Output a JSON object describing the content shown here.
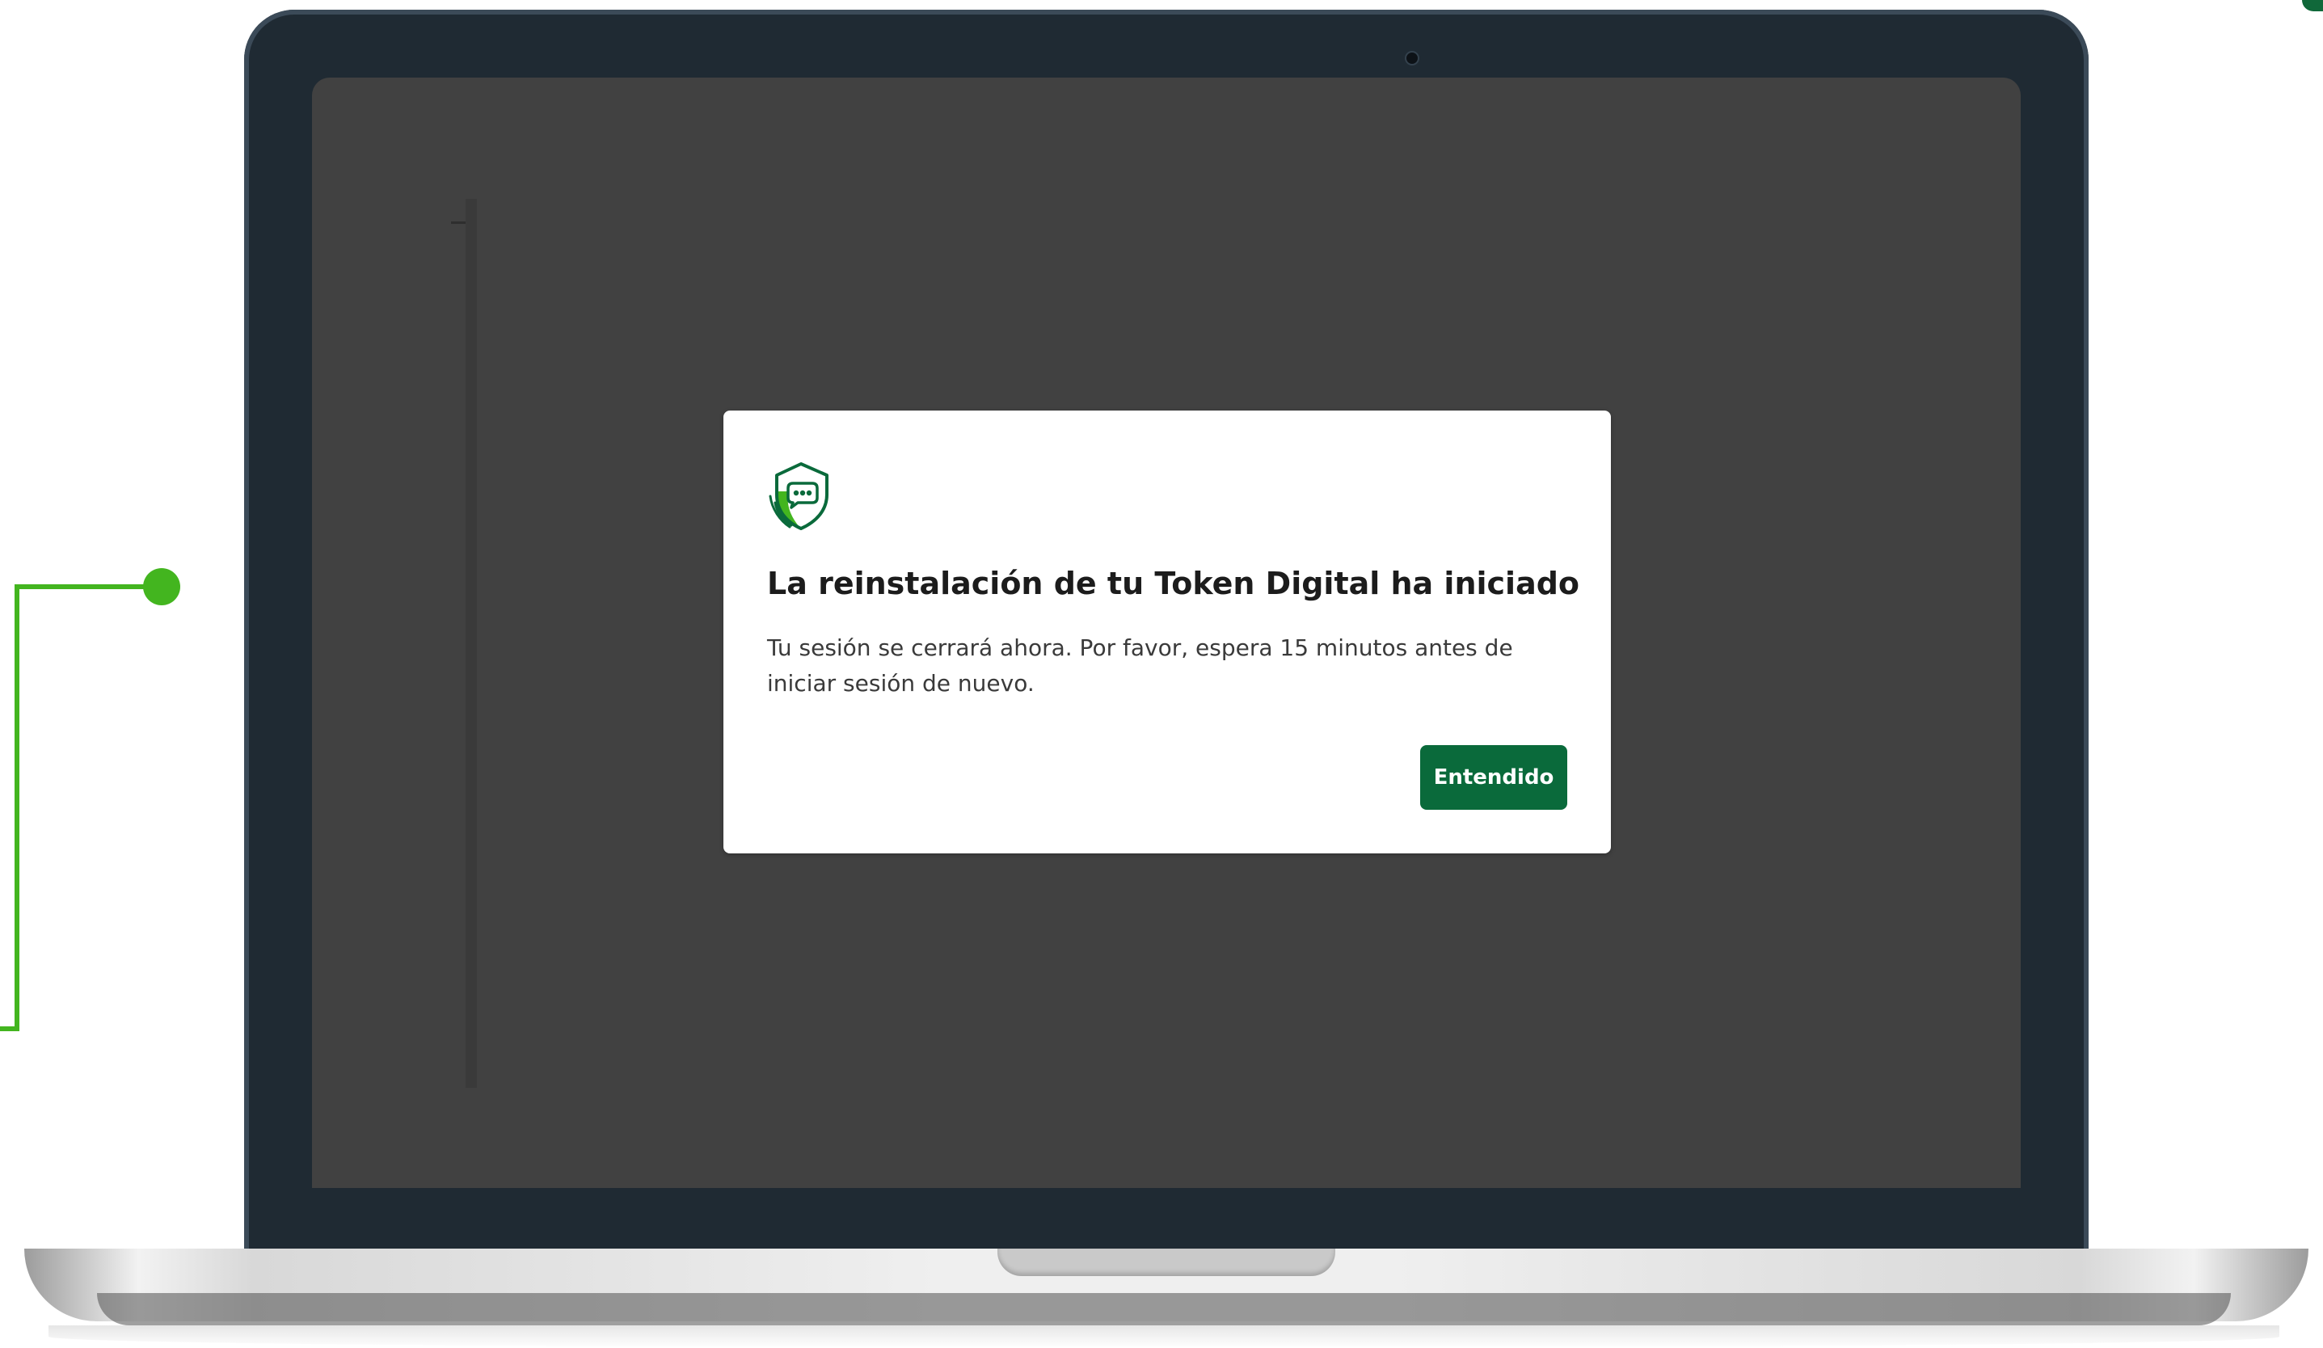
{
  "dialog": {
    "icon": "shield-dots-icon",
    "title": "La reinstalación de tu Token Digital ha iniciado",
    "body": "Tu sesión se cerrará ahora. Por favor, espera 15 minutos antes de iniciar sesión de nuevo.",
    "button_label": "Entendido"
  },
  "colors": {
    "primary_button": "#0a6a3b",
    "accent_green": "#43b51f",
    "overlay": "#414141",
    "laptop_frame": "#1f2a33"
  }
}
